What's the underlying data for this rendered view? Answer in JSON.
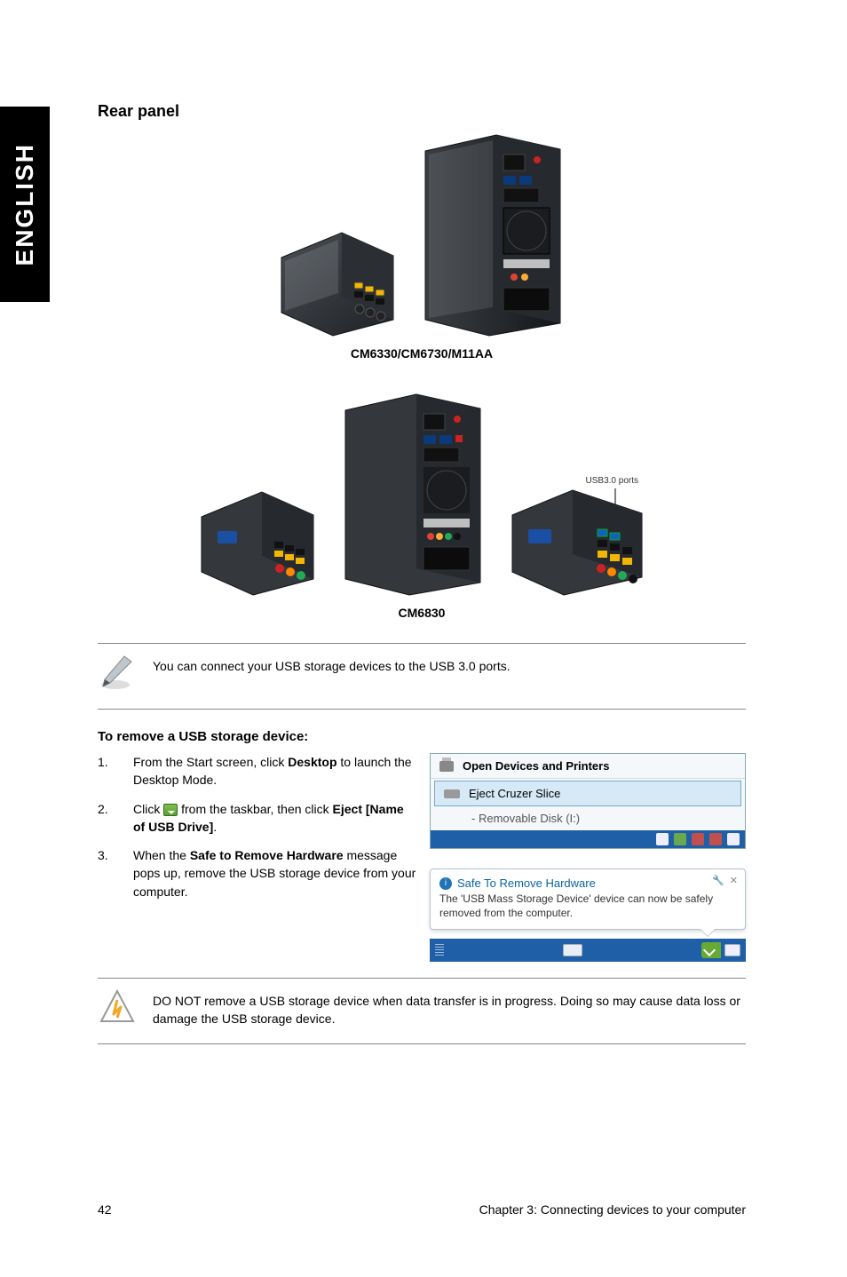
{
  "sideTab": "ENGLISH",
  "headings": {
    "rearPanel": "Rear panel",
    "removeUsb": "To remove a USB storage device:"
  },
  "captions": {
    "row1": "CM6330/CM6730/M11AA",
    "row2": "CM6830"
  },
  "labels": {
    "usb3": "USB3.0 ports"
  },
  "notes": {
    "usbConnect": "You can connect your USB storage devices to the USB 3.0 ports.",
    "doNotRemove": "DO NOT remove a USB storage device when data transfer is in progress. Doing so may cause data loss or damage the USB storage device."
  },
  "steps": {
    "s1": {
      "num": "1.",
      "pre": "From the Start screen, click ",
      "bold": "Desktop",
      "post": " to launch the Desktop Mode."
    },
    "s2": {
      "num": "2.",
      "pre": "Click ",
      "mid": " from the taskbar, then click ",
      "bold1": "Eject [Name of USB Drive]",
      "post": "."
    },
    "s3": {
      "num": "3.",
      "pre": "When the ",
      "bold": "Safe to Remove Hardware",
      "post": " message pops up, remove the USB storage device from your computer."
    }
  },
  "menu": {
    "openDevices": "Open Devices and Printers",
    "eject": "Eject Cruzer Slice",
    "removable": "Removable Disk (I:)"
  },
  "balloon": {
    "title": "Safe To Remove Hardware",
    "msg": "The 'USB Mass Storage Device' device can now be safely removed from the computer."
  },
  "footer": {
    "page": "42",
    "chapter": "Chapter 3: Connecting devices to your computer"
  }
}
